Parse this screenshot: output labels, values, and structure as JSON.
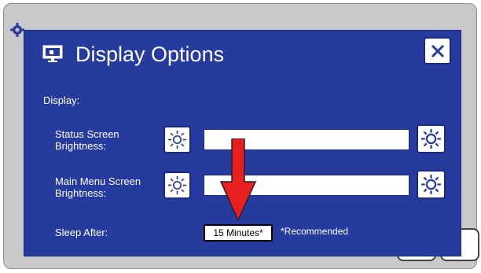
{
  "dialog": {
    "title": "Display Options",
    "section_label": "Display:",
    "rows": [
      {
        "label": "Status Screen Brightness:"
      },
      {
        "label": "Main Menu Screen Brightness:"
      }
    ],
    "sleep": {
      "label": "Sleep After:",
      "value": "15 Minutes*",
      "note": "*Recommended"
    }
  },
  "icons": {
    "title": "display-icon",
    "close": "close-icon",
    "decrease": "sun-dim-icon",
    "increase": "sun-bright-icon",
    "annotation": "red-arrow"
  },
  "colors": {
    "dialog_bg": "#273a9e",
    "arrow": "#e81f1f",
    "device_bg": "#c9c9c9"
  }
}
